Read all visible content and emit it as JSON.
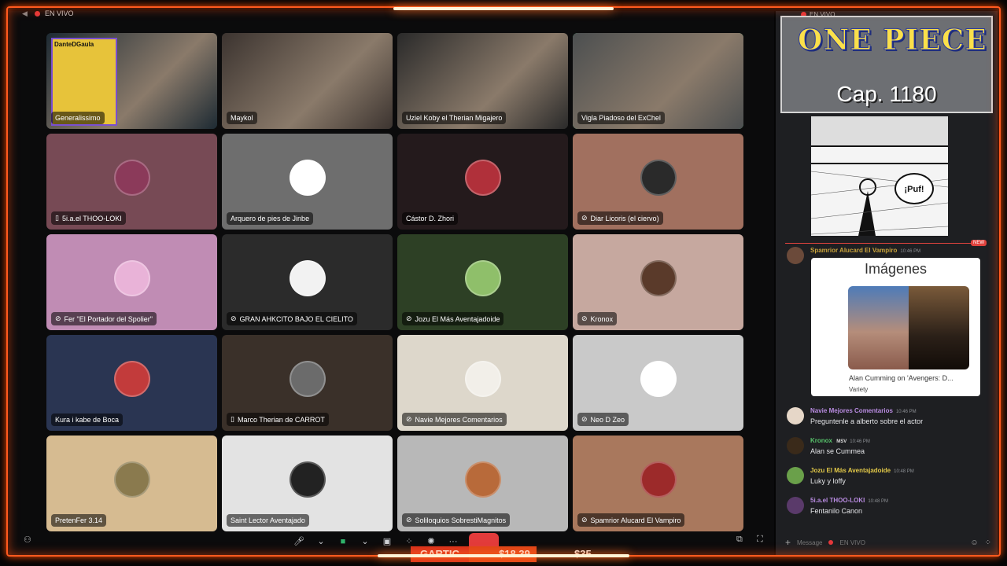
{
  "stream": {
    "live_label": "EN VIVO"
  },
  "grid": {
    "tiles": [
      {
        "name": "Generalissimo",
        "bg": "#1d2a33",
        "speaking": false,
        "video": true,
        "overlay": "DanteDGaula"
      },
      {
        "name": "Maykol",
        "bg": "#3c3430",
        "speaking": false,
        "video": true
      },
      {
        "name": "Uziel Koby el Therian Migajero",
        "bg": "#2a2a2a",
        "speaking": false,
        "video": true
      },
      {
        "name": "Vigla Piadoso del ExChel",
        "bg": "#4c4f50",
        "speaking": true,
        "video": true
      },
      {
        "name": "5i.a.el THOO-LOKI",
        "bg": "#774a55",
        "icon": "phone-icon"
      },
      {
        "name": "Arquero de pies de Jinbe",
        "bg": "#6e6e6e"
      },
      {
        "name": "Cástor D. Zhori",
        "bg": "#241a1c"
      },
      {
        "name": "Diar Licoris (el ciervo)",
        "bg": "#a1705f",
        "icon": "mic-off-icon"
      },
      {
        "name": "Fer \"El Portador del Spolier\"",
        "bg": "#c08cb4",
        "icon": "mic-off-icon"
      },
      {
        "name": "GRAN AHKCITO BAJO EL CIELITO",
        "bg": "#2b2b2b",
        "icon": "mic-off-icon"
      },
      {
        "name": "Jozu El Más Aventajadoide",
        "bg": "#2d4025",
        "icon": "mic-off-icon"
      },
      {
        "name": "Kronox",
        "bg": "#c6a89f",
        "icon": "mic-off-icon"
      },
      {
        "name": "Kura i kabe de Boca",
        "bg": "#2a3552"
      },
      {
        "name": "Marco Therian de CARROT",
        "bg": "#3a3029",
        "icon": "phone-icon"
      },
      {
        "name": "Navie Mejores Comentarios",
        "bg": "#ddd7cb",
        "icon": "mic-off-icon"
      },
      {
        "name": "Neo D Zeo",
        "bg": "#c9c9c9",
        "icon": "mic-off-icon"
      },
      {
        "name": "PretenFer 3.14",
        "bg": "#d6bb91"
      },
      {
        "name": "Saint Lector Aventajado",
        "bg": "#e3e3e3"
      },
      {
        "name": "Soliloquios SobrestiMagnitos",
        "bg": "#b8b8b8",
        "icon": "mic-off-icon"
      },
      {
        "name": "Spamrior Alucard El Vampiro",
        "bg": "#a9785d",
        "icon": "mic-off-icon"
      }
    ]
  },
  "overlay": {
    "show_title": "ONE PIECE",
    "chapter": "Cap. 1180",
    "gartic_name": "GARTIC",
    "gartic_amount": "$18.39",
    "amount2": "$35"
  },
  "chat": {
    "live_label": "EN VIVO",
    "new_tag": "NEW",
    "manga_sfx": "¡Puf!",
    "embed": {
      "author": "Spamrior Alucard El Vampiro",
      "author_color": "#c9a33c",
      "time": "10:46 PM",
      "title": "Imágenes",
      "caption": "Alan Cumming on 'Avengers: D...",
      "source": "Variety"
    },
    "messages": [
      {
        "author": "Navie Mejores Comentarios",
        "color": "#b88be0",
        "time": "10:46 PM",
        "text": "Preguntenle a alberto sobre el actor",
        "badge": ""
      },
      {
        "author": "Kronox",
        "color": "#57c36b",
        "time": "10:46 PM",
        "text": "Alan se Cummea",
        "badge": "MSV"
      },
      {
        "author": "Jozu El Más Aventajadoide",
        "color": "#e3c948",
        "time": "10:48 PM",
        "text": "Luky y loffy",
        "badge": ""
      },
      {
        "author": "5i.a.el THOO-LOKI",
        "color": "#b88be0",
        "time": "10:48 PM",
        "text": "Fentanilo Canon",
        "badge": ""
      }
    ],
    "input_placeholder": "Message",
    "input_live": "EN VIVO"
  }
}
